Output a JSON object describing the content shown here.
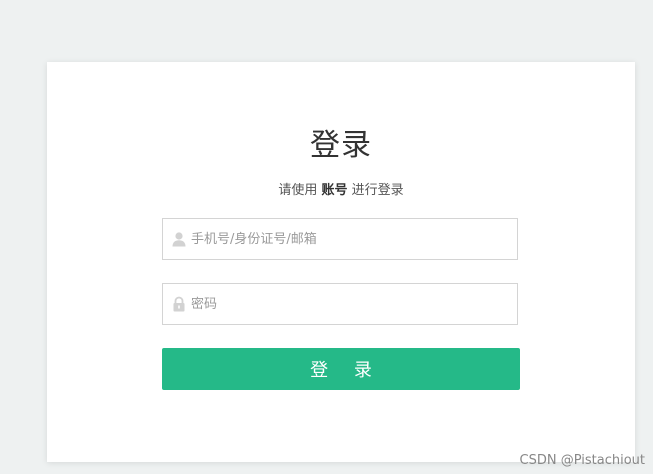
{
  "login": {
    "title": "登录",
    "subtitle_prefix": "请使用 ",
    "subtitle_emphasis": "账号",
    "subtitle_suffix": " 进行登录",
    "username_placeholder": "手机号/身份证号/邮箱",
    "password_placeholder": "密码",
    "button_label": "登 录"
  },
  "watermark": "CSDN @Pistachiout",
  "colors": {
    "page_bg": "#eef1f1",
    "card_bg": "#ffffff",
    "button_bg": "#25b988",
    "title_text": "#333333"
  },
  "icons": {
    "username": "user-icon",
    "password": "lock-icon"
  }
}
